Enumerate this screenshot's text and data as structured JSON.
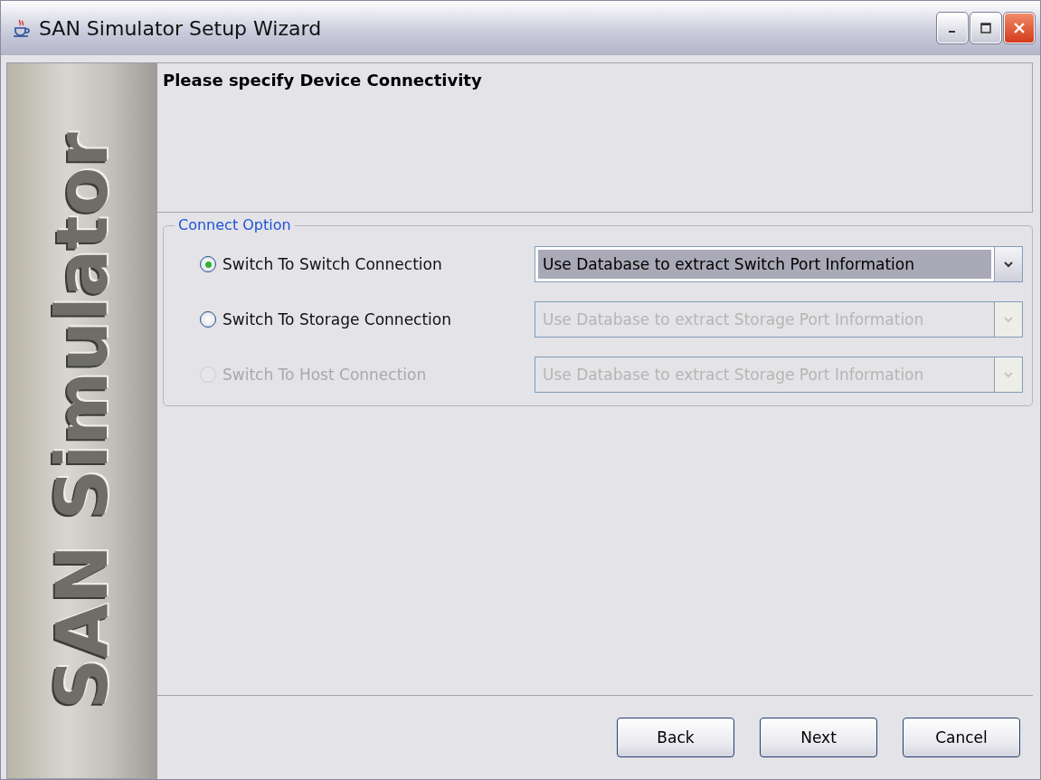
{
  "window": {
    "title": "SAN Simulator Setup Wizard"
  },
  "sidebar": {
    "logo_text": "SAN Simulator"
  },
  "header": {
    "title": "Please specify Device Connectivity"
  },
  "connect_option": {
    "legend": "Connect Option",
    "options": [
      {
        "label": "Switch To Switch Connection",
        "selected": true,
        "disabled": false,
        "combo": {
          "value": "Use Database to extract Switch Port Information",
          "disabled": false
        }
      },
      {
        "label": "Switch To Storage Connection",
        "selected": false,
        "disabled": false,
        "combo": {
          "value": "Use Database to extract Storage Port Information",
          "disabled": true
        }
      },
      {
        "label": "Switch To Host Connection",
        "selected": false,
        "disabled": true,
        "combo": {
          "value": "Use Database to extract Storage Port Information",
          "disabled": true
        }
      }
    ]
  },
  "buttons": [
    "Back",
    "Next",
    "Cancel"
  ]
}
